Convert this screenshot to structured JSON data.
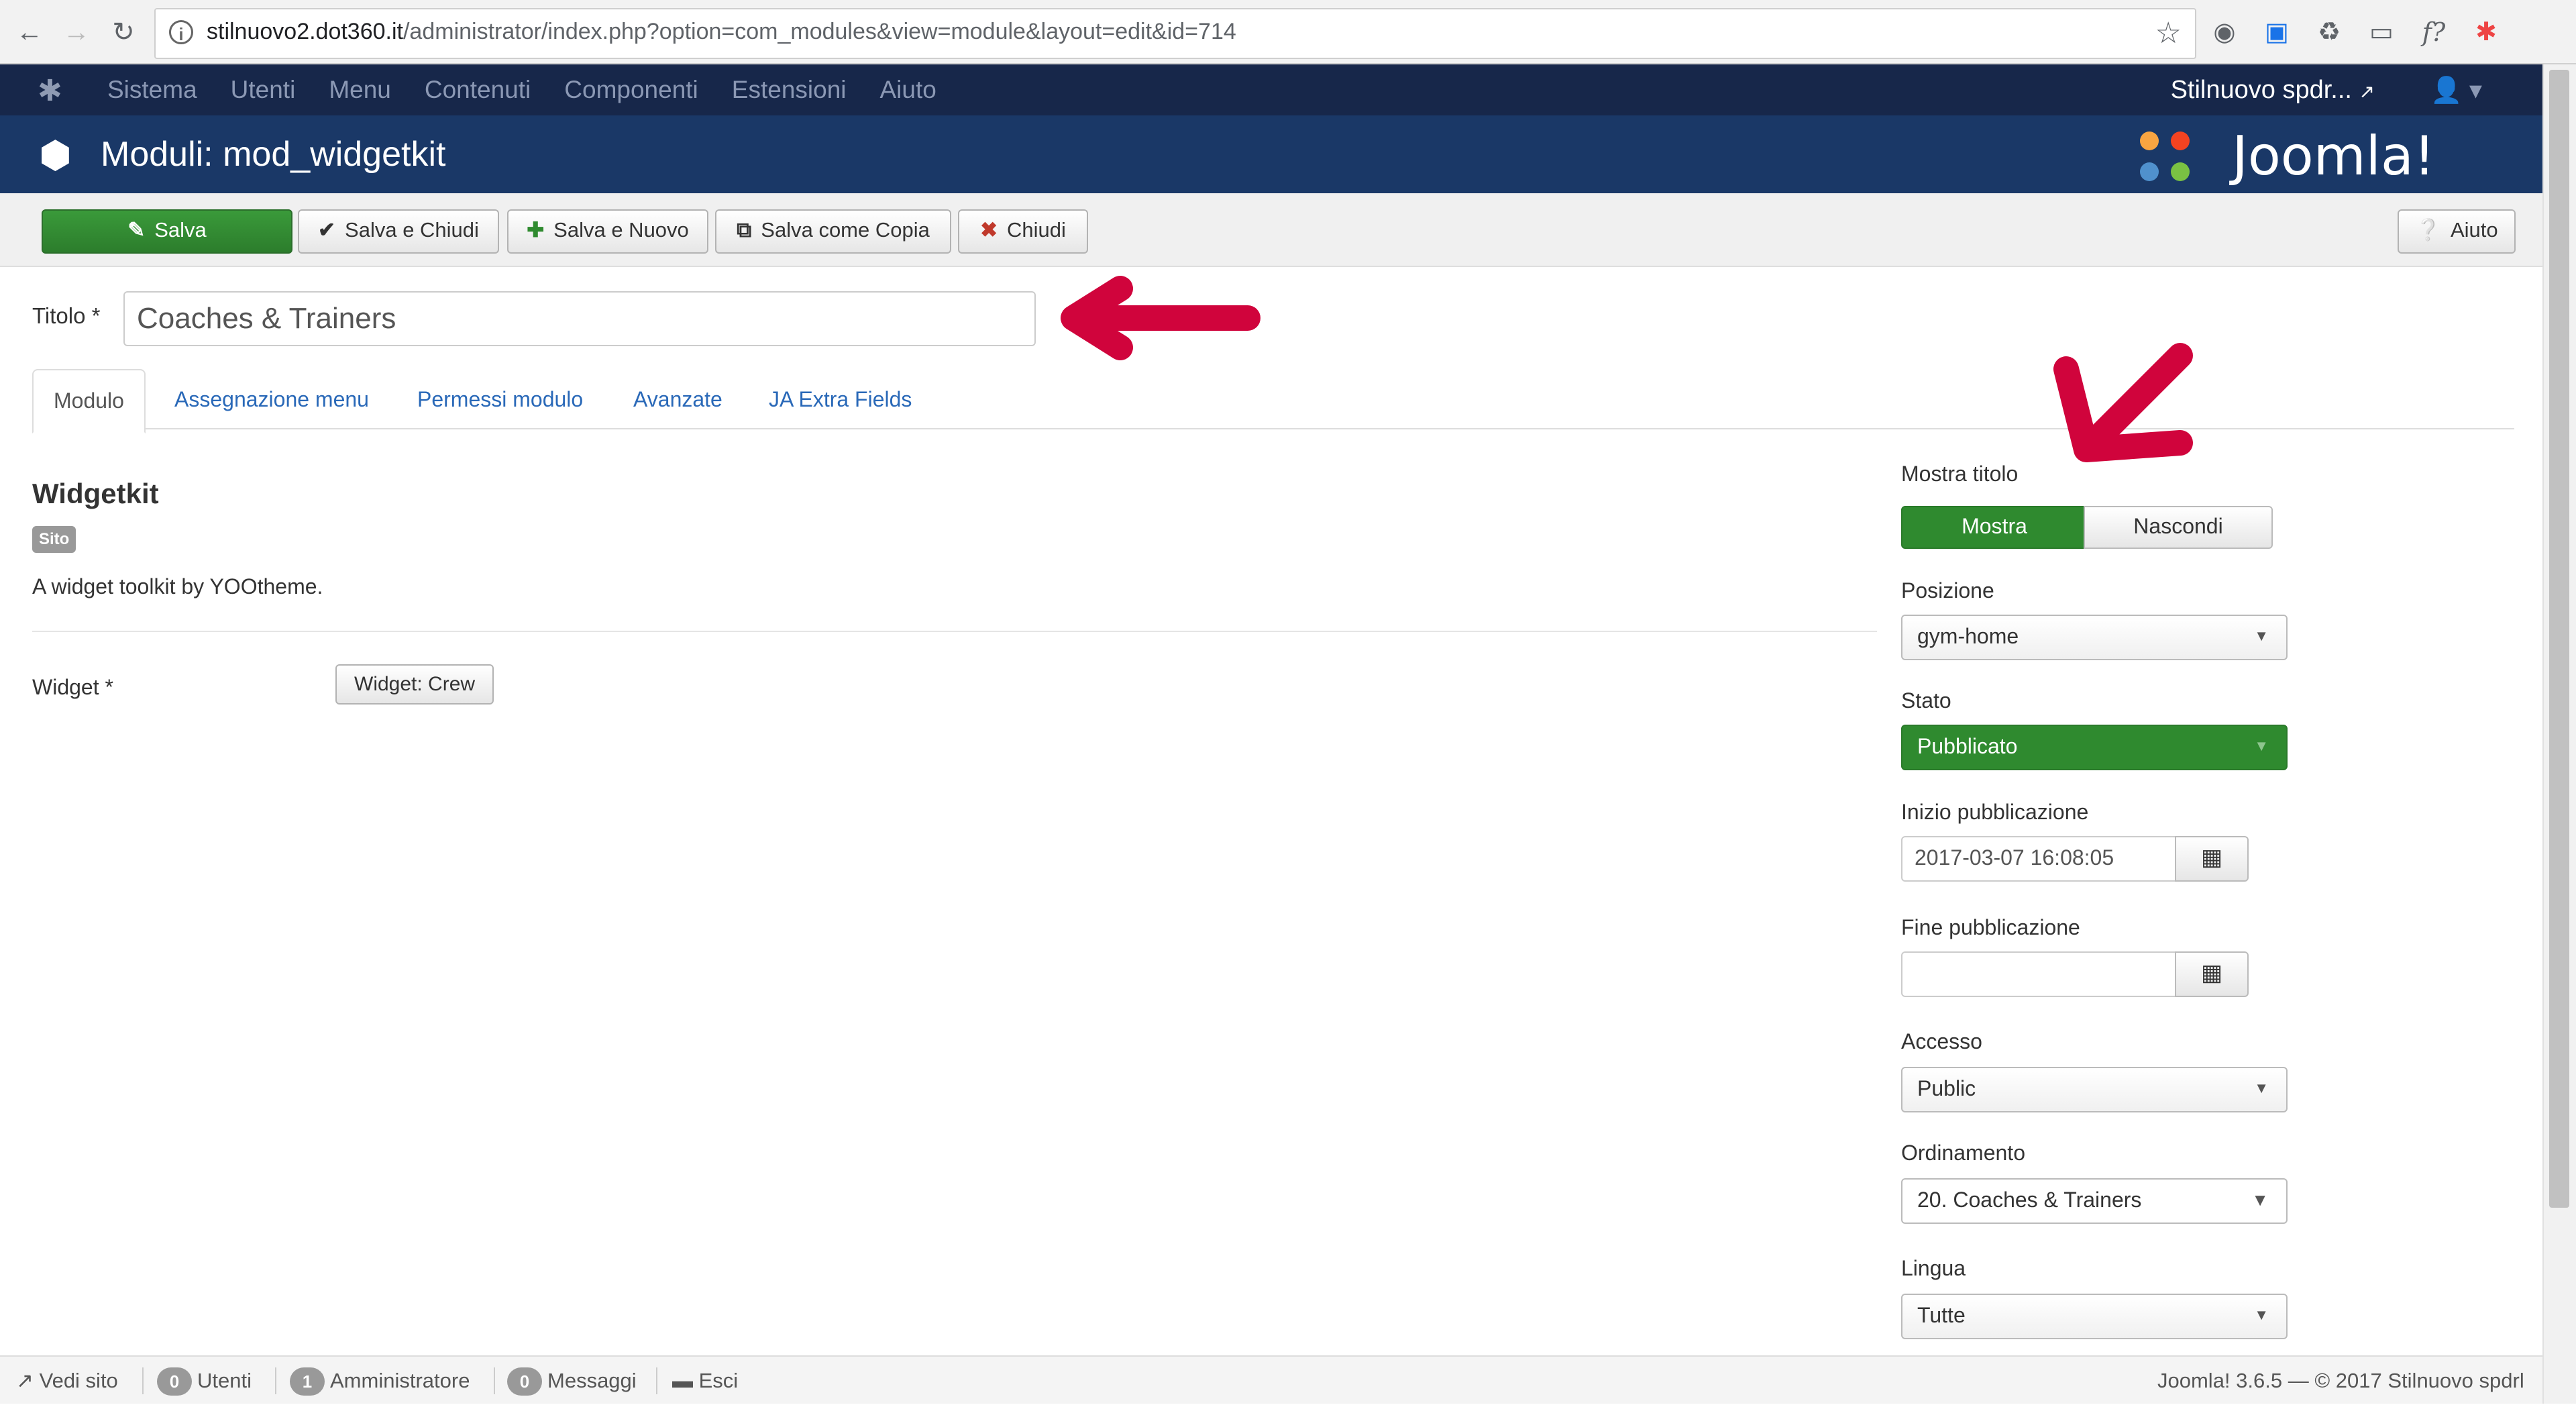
{
  "browser": {
    "url_host": "stilnuovo2.dot360.it",
    "url_path": "/administrator/index.php?option=com_modules&view=module&layout=edit&id=714"
  },
  "topnav": {
    "menu": [
      "Sistema",
      "Utenti",
      "Menu",
      "Contenuti",
      "Componenti",
      "Estensioni",
      "Aiuto"
    ],
    "site_name": "Stilnuovo spdr..."
  },
  "header": {
    "title": "Moduli: mod_widgetkit",
    "brand": "Joomla!"
  },
  "toolbar": {
    "save": "Salva",
    "save_close": "Salva e Chiudi",
    "save_new": "Salva e Nuovo",
    "save_copy": "Salva come Copia",
    "close": "Chiudi",
    "help": "Aiuto"
  },
  "form": {
    "title_label": "Titolo *",
    "title_value": "Coaches & Trainers"
  },
  "tabs": [
    "Modulo",
    "Assegnazione menu",
    "Permessi modulo",
    "Avanzate",
    "JA Extra Fields"
  ],
  "module": {
    "name": "Widgetkit",
    "badge": "Sito",
    "description": "A widget toolkit by YOOtheme.",
    "widget_label": "Widget *",
    "widget_value": "Widget: Crew"
  },
  "sidebar": {
    "show_title_label": "Mostra titolo",
    "show": "Mostra",
    "hide": "Nascondi",
    "position_label": "Posizione",
    "position_value": "gym-home",
    "status_label": "Stato",
    "status_value": "Pubblicato",
    "publish_up_label": "Inizio pubblicazione",
    "publish_up_value": "2017-03-07 16:08:05",
    "publish_down_label": "Fine pubblicazione",
    "publish_down_value": "",
    "access_label": "Accesso",
    "access_value": "Public",
    "ordering_label": "Ordinamento",
    "ordering_value": "20. Coaches & Trainers",
    "language_label": "Lingua",
    "language_value": "Tutte"
  },
  "footer": {
    "view_site": "Vedi sito",
    "users_count": "0",
    "users": "Utenti",
    "admin_count": "1",
    "admin": "Amministratore",
    "messages_count": "0",
    "messages": "Messaggi",
    "logout": "Esci",
    "version": "Joomla! 3.6.5",
    "copyright": "— © 2017 Stilnuovo spdrl"
  },
  "colors": {
    "topnav": "#17274a",
    "header": "#1a3867",
    "success": "#2f8a2f",
    "annotation": "#d0043c"
  }
}
